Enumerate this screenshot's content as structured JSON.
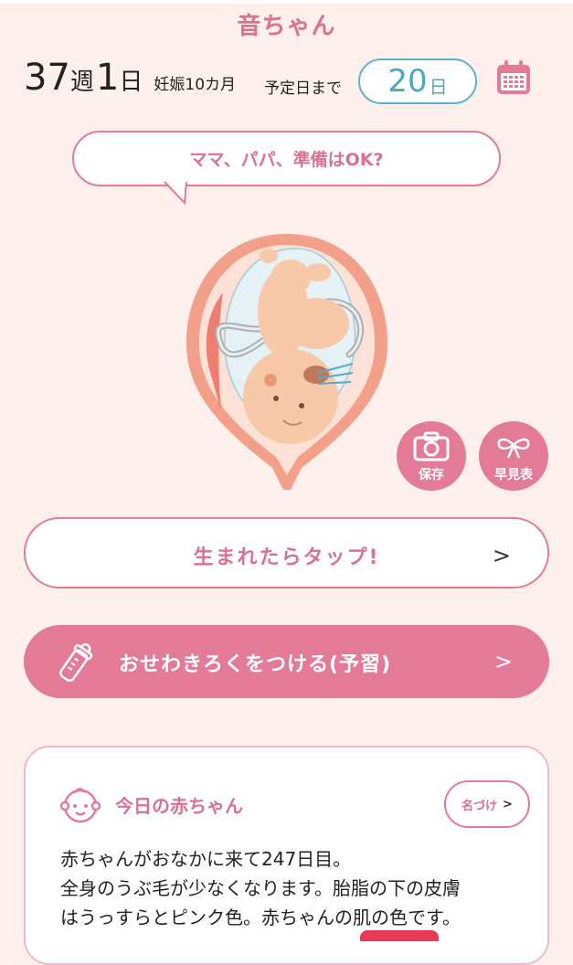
{
  "app": {
    "title": "音ちゃん"
  },
  "pregnancy": {
    "weeks": "37",
    "week_unit": "週",
    "days": "1",
    "day_unit": "日",
    "month_label": "妊娠10カ月",
    "until_label": "予定日まで",
    "remaining_days": "20",
    "remaining_unit": "日"
  },
  "bubble": {
    "message": "ママ、パパ、準備はOK?"
  },
  "actions": {
    "save_label": "保存",
    "chart_label": "早見表"
  },
  "born_button": {
    "label": "生まれたらタップ!",
    "chevron": ">"
  },
  "diaper_button": {
    "label": "おせわきろくをつける(予習)",
    "chevron": ">"
  },
  "today_card": {
    "title": "今日の赤ちゃん",
    "naming_label": "名づけ",
    "naming_chevron": ">",
    "lines": [
      "赤ちゃんがおなかに来て247日目。",
      "全身のうぶ毛が少なくなります。胎脂の下の皮膚",
      "はうっすらとピンク色。赤ちゃんの肌の色です。"
    ]
  },
  "colors": {
    "accent": "#e27a98",
    "accent_text": "#d9728e",
    "teal": "#4aa9c1",
    "background": "#fdf0ec"
  },
  "icons": [
    "calendar-icon",
    "camera-icon",
    "ribbon-icon",
    "baby-bottle-icon",
    "baby-face-icon",
    "chevron-right-icon"
  ]
}
